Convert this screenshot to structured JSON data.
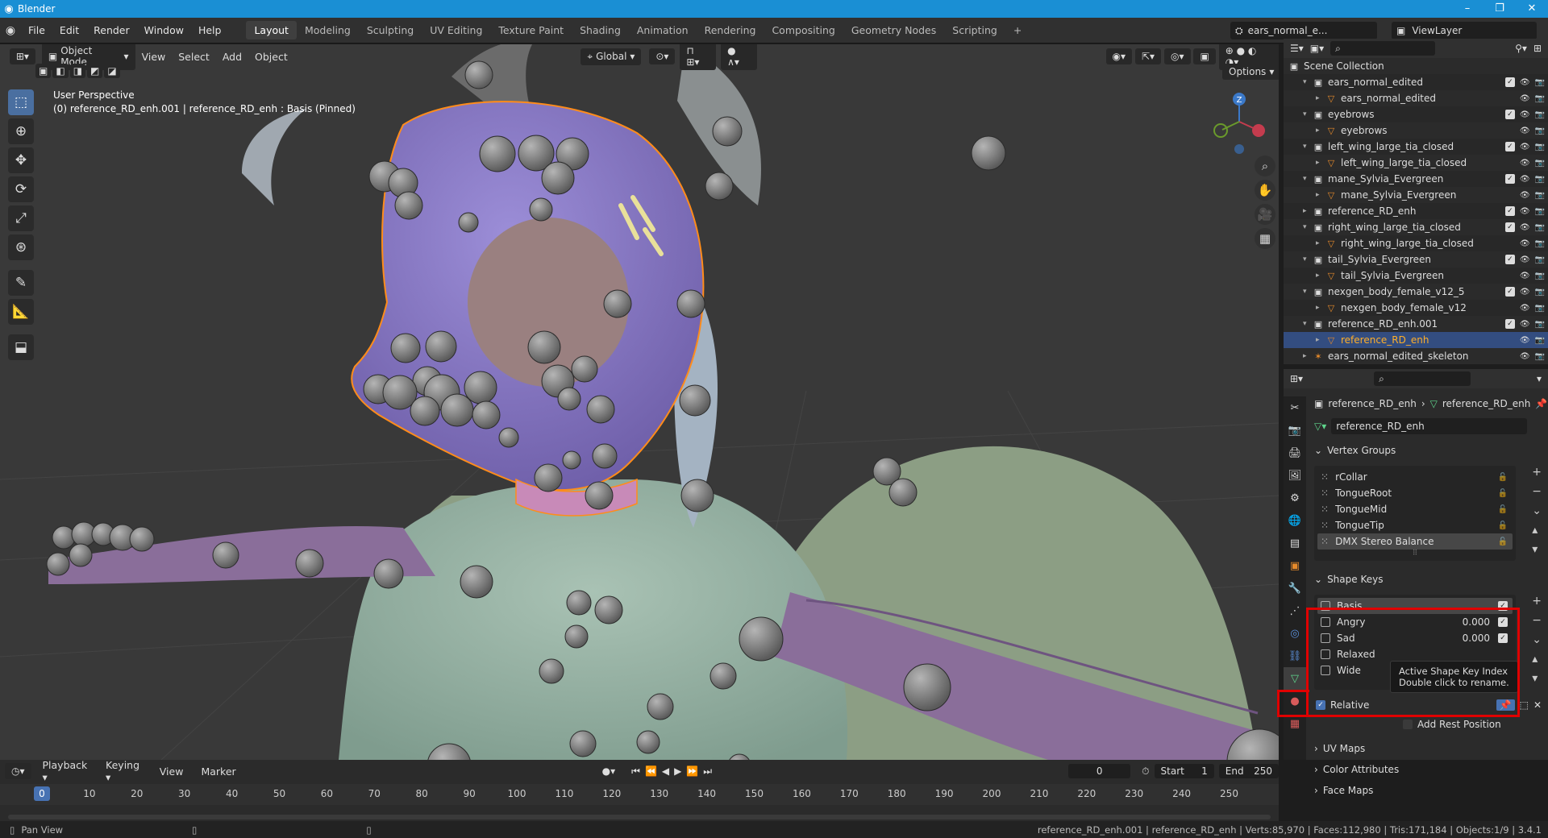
{
  "title": {
    "app": "Blender",
    "minimize": "–",
    "restore": "❐",
    "close": "✕"
  },
  "menu": [
    "File",
    "Edit",
    "Render",
    "Window",
    "Help"
  ],
  "workspaces": [
    "Layout",
    "Modeling",
    "Sculpting",
    "UV Editing",
    "Texture Paint",
    "Shading",
    "Animation",
    "Rendering",
    "Compositing",
    "Geometry Nodes",
    "Scripting"
  ],
  "scene": {
    "name": "ears_normal_e...",
    "view_layer": "ViewLayer"
  },
  "viewport": {
    "mode": "Object Mode",
    "menus": [
      "View",
      "Select",
      "Add",
      "Object"
    ],
    "transform_orientation": "Global",
    "options": "Options",
    "info_line1": "User Perspective",
    "info_line2": "(0) reference_RD_enh.001 | reference_RD_enh : Basis (Pinned)",
    "gizmo": {
      "z": "Z"
    }
  },
  "outliner": {
    "root": "Scene Collection",
    "rows": [
      {
        "label": "ears_normal_edited",
        "level": 1,
        "type": "collection"
      },
      {
        "label": "ears_normal_edited",
        "level": 2,
        "type": "mesh"
      },
      {
        "label": "eyebrows",
        "level": 1,
        "type": "collection"
      },
      {
        "label": "eyebrows",
        "level": 2,
        "type": "mesh"
      },
      {
        "label": "left_wing_large_tia_closed",
        "level": 1,
        "type": "collection"
      },
      {
        "label": "left_wing_large_tia_closed",
        "level": 2,
        "type": "mesh"
      },
      {
        "label": "mane_Sylvia_Evergreen",
        "level": 1,
        "type": "collection"
      },
      {
        "label": "mane_Sylvia_Evergreen",
        "level": 2,
        "type": "mesh"
      },
      {
        "label": "reference_RD_enh",
        "level": 1,
        "type": "collection"
      },
      {
        "label": "right_wing_large_tia_closed",
        "level": 1,
        "type": "collection"
      },
      {
        "label": "right_wing_large_tia_closed",
        "level": 2,
        "type": "mesh"
      },
      {
        "label": "tail_Sylvia_Evergreen",
        "level": 1,
        "type": "collection"
      },
      {
        "label": "tail_Sylvia_Evergreen",
        "level": 2,
        "type": "mesh"
      },
      {
        "label": "nexgen_body_female_v12_5",
        "level": 1,
        "type": "collection"
      },
      {
        "label": "nexgen_body_female_v12",
        "level": 2,
        "type": "mesh"
      },
      {
        "label": "reference_RD_enh.001",
        "level": 1,
        "type": "collection"
      },
      {
        "label": "reference_RD_enh",
        "level": 2,
        "type": "mesh",
        "selected": true
      },
      {
        "label": "ears_normal_edited_skeleton",
        "level": 1,
        "type": "armature"
      }
    ]
  },
  "properties": {
    "breadcrumb_object": "reference_RD_enh",
    "breadcrumb_data": "reference_RD_enh",
    "data_name": "reference_RD_enh",
    "vertex_groups_title": "Vertex Groups",
    "vertex_groups": [
      "rCollar",
      "TongueRoot",
      "TongueMid",
      "TongueTip",
      "DMX Stereo Balance"
    ],
    "shape_keys_title": "Shape Keys",
    "shape_keys": [
      {
        "name": "Basis",
        "value": ""
      },
      {
        "name": "Angry",
        "value": "0.000"
      },
      {
        "name": "Sad",
        "value": "0.000"
      },
      {
        "name": "Relaxed",
        "value": ""
      },
      {
        "name": "Wide",
        "value": ""
      }
    ],
    "tooltip_line1": "Active Shape Key Index",
    "tooltip_line2": "Double click to rename.",
    "relative_label": "Relative",
    "add_rest_label": "Add Rest Position",
    "sections": [
      "UV Maps",
      "Color Attributes",
      "Face Maps"
    ]
  },
  "timeline": {
    "menus": [
      "Playback",
      "Keying",
      "View",
      "Marker"
    ],
    "current_frame": "0",
    "start_label": "Start",
    "start": "1",
    "end_label": "End",
    "end": "250",
    "ticks": [
      "0",
      "10",
      "20",
      "30",
      "40",
      "50",
      "60",
      "70",
      "80",
      "90",
      "100",
      "110",
      "120",
      "130",
      "140",
      "150",
      "160",
      "170",
      "180",
      "190",
      "200",
      "210",
      "220",
      "230",
      "240",
      "250"
    ]
  },
  "status": {
    "left": "Pan View",
    "right": "reference_RD_enh.001 | reference_RD_enh | Verts:85,970 | Faces:112,980 | Tris:171,184 | Objects:1/9 | 3.4.1"
  },
  "colors": {
    "accent": "#4772b3",
    "highlight": "#e00000",
    "selection_outline": "#ff8c1a"
  }
}
